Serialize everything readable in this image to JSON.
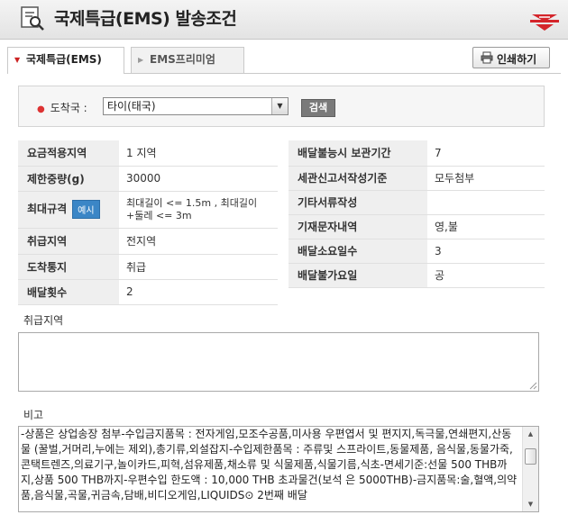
{
  "header": {
    "title": "국제특급(EMS) 발송조건"
  },
  "tabs": [
    {
      "label": "국제특급(EMS)"
    },
    {
      "label": "EMS프리미엄"
    }
  ],
  "toolbar": {
    "print_label": "인쇄하기"
  },
  "search": {
    "dest_label": "도착국 :",
    "dest_value": "타이(태국)",
    "button_label": "검색"
  },
  "info_left": [
    {
      "label": "요금적용지역",
      "value": "1 지역"
    },
    {
      "label": "제한중량(g)",
      "value": "30000"
    },
    {
      "label": "최대규격",
      "badge": "예시",
      "value": "최대길이 <= 1.5m , 최대길이+둘레 <= 3m"
    },
    {
      "label": "취급지역",
      "value": "전지역"
    },
    {
      "label": "도착통지",
      "value": "취급"
    },
    {
      "label": "배달횟수",
      "value": "2"
    }
  ],
  "info_right": [
    {
      "label": "배달불능시 보관기간",
      "value": "7"
    },
    {
      "label": "세관신고서작성기준",
      "value": "모두첨부"
    },
    {
      "label": "기타서류작성",
      "value": ""
    },
    {
      "label": "기재문자내역",
      "value": "영,불"
    },
    {
      "label": "배달소요일수",
      "value": "3"
    },
    {
      "label": "배달불가요일",
      "value": "공"
    }
  ],
  "area_label": "취급지역",
  "area_text": "",
  "remarks_label": "비고",
  "remarks_text": "-상품은 상업송장 첨부-수입금지품목 : 전자게임,모조수공품,미사용 우편엽서 및 편지지,독극물,연쇄편지,산동물 (꿀벌,거머리,누에는 제외),총기류,외설잡지-수입제한품목 : 주류및 스프라이트,동물제품, 음식물,동물가죽,콘택트렌즈,의료기구,놀이카드,피혁,섬유제품,채소류 및 식물제품,식물기름,식초-면세기준:선물 500 THB까지,상품 500 THB까지-우편수입 한도액 : 10,000 THB 초과물건(보석 은 5000THB)-금지품목:술,혈액,의약품,음식물,곡물,귀금속,담배,비디오게임,LIQUIDS⊙ 2번째 배달",
  "colors": {
    "accent_red": "#cc2222",
    "badge_blue": "#3b86c6",
    "header_cell": "#efefef"
  },
  "icons": [
    "search-document-icon",
    "post-logo-icon",
    "printer-icon",
    "dropdown-arrow-icon",
    "scroll-up-icon",
    "scroll-down-icon"
  ]
}
